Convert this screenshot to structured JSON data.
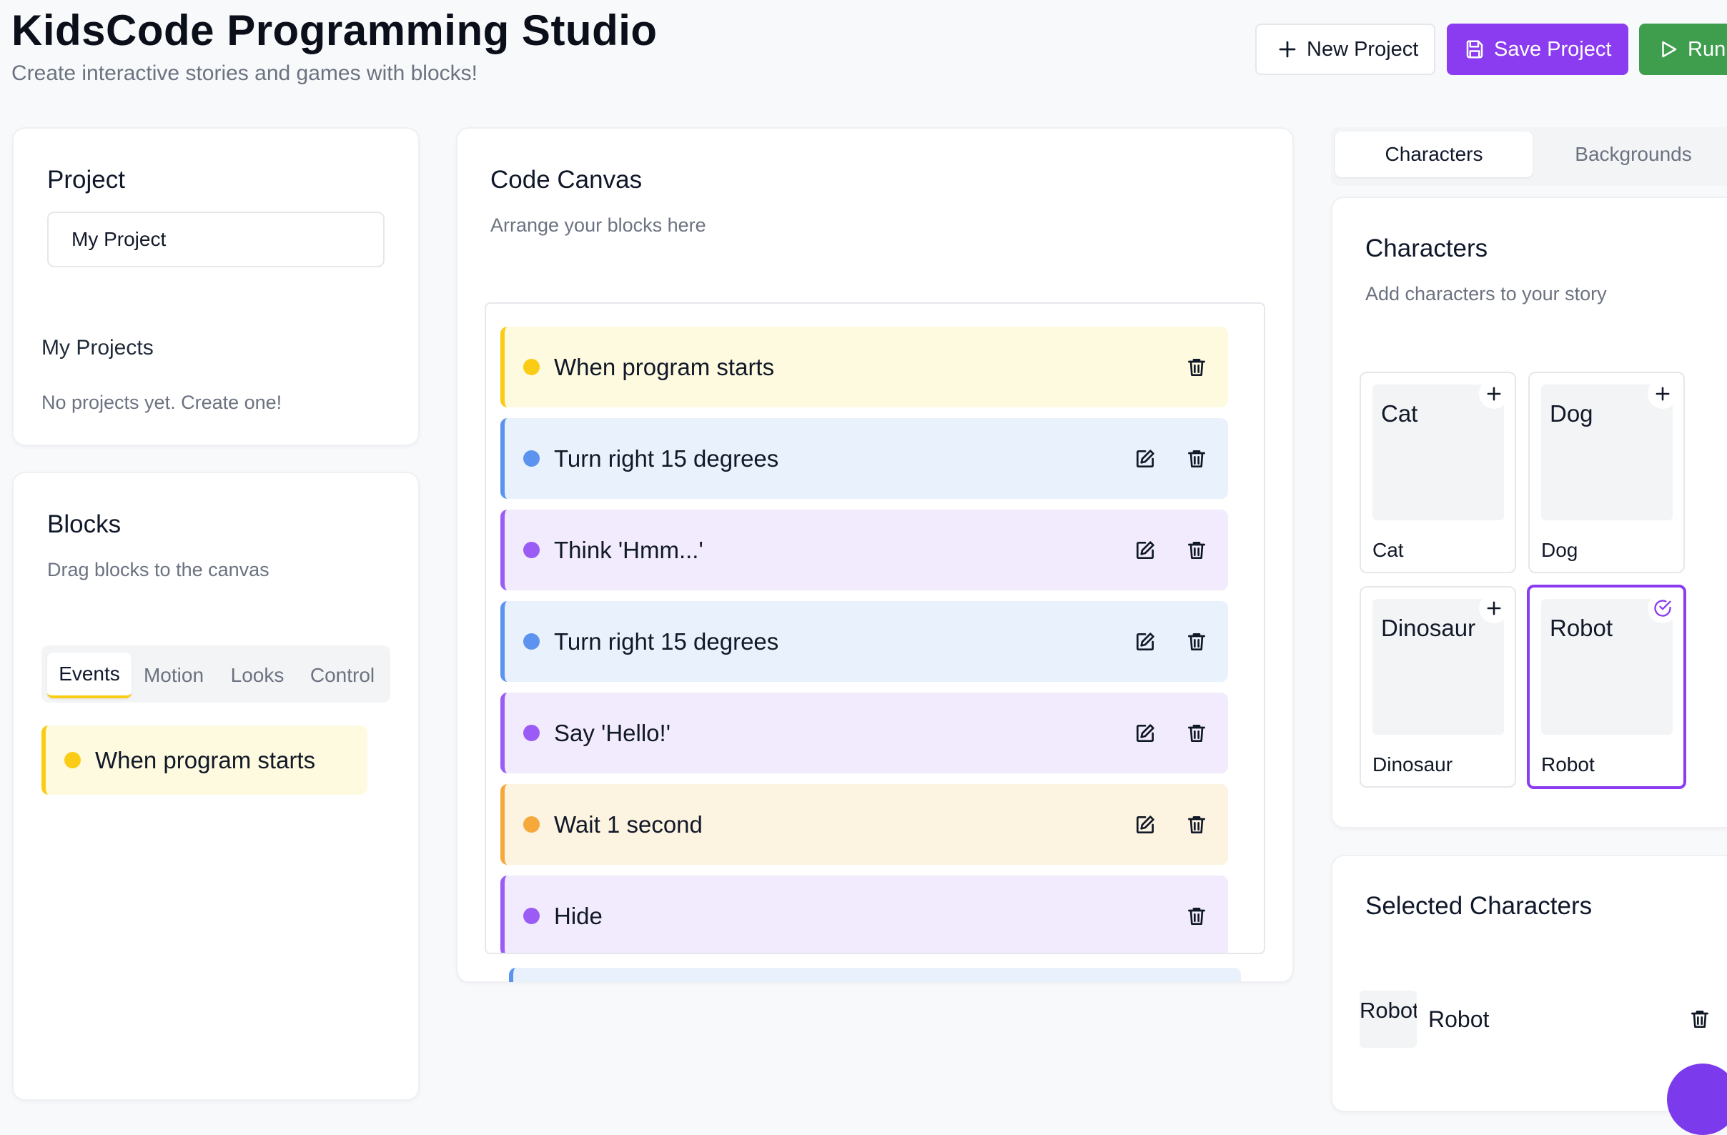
{
  "header": {
    "title": "KidsCode Programming Studio",
    "subtitle": "Create interactive stories and games with blocks!",
    "new_project_label": "New Project",
    "save_project_label": "Save Project",
    "run_label": "Run"
  },
  "project_panel": {
    "title": "Project",
    "name_value": "My Project",
    "my_projects_title": "My Projects",
    "empty_text": "No projects yet. Create one!"
  },
  "blocks_panel": {
    "title": "Blocks",
    "description": "Drag blocks to the canvas",
    "tabs": [
      "Events",
      "Motion",
      "Looks",
      "Control"
    ],
    "active_tab": "Events",
    "palette": [
      {
        "label": "When program starts",
        "category": "events"
      }
    ]
  },
  "canvas": {
    "title": "Code Canvas",
    "description": "Arrange your blocks here",
    "blocks": [
      {
        "label": "When program starts",
        "category": "events",
        "editable": false
      },
      {
        "label": "Turn right 15 degrees",
        "category": "motion",
        "editable": true
      },
      {
        "label": "Think 'Hmm...'",
        "category": "looks",
        "editable": true
      },
      {
        "label": "Turn right 15 degrees",
        "category": "motion",
        "editable": true
      },
      {
        "label": "Say 'Hello!'",
        "category": "looks",
        "editable": true
      },
      {
        "label": "Wait 1 second",
        "category": "control",
        "editable": true
      },
      {
        "label": "Hide",
        "category": "looks",
        "editable": false
      },
      {
        "label": "",
        "category": "motion",
        "editable": false
      }
    ]
  },
  "right_panel": {
    "tabs": [
      "Characters",
      "Backgrounds"
    ],
    "active_tab": "Characters",
    "characters_title": "Characters",
    "characters_description": "Add characters to your story",
    "characters": [
      {
        "name": "Cat",
        "thumb_text": "Cat",
        "selected": false
      },
      {
        "name": "Dog",
        "thumb_text": "Dog",
        "selected": false
      },
      {
        "name": "Dinosaur",
        "thumb_text": "Dinosaur",
        "selected": false
      },
      {
        "name": "Robot",
        "thumb_text": "Robot",
        "selected": true
      }
    ],
    "selected_title": "Selected Characters",
    "selected": [
      {
        "name": "Robot",
        "thumb_text": "Robot"
      }
    ]
  },
  "colors": {
    "accent_purple": "#8b3cf0",
    "run_green": "#3f9e4e",
    "events_yellow": "#facc15",
    "motion_blue": "#5b93ef",
    "looks_purple": "#9b5cf6",
    "control_orange": "#f5a93b"
  },
  "icons": {
    "new": "plus-icon",
    "save": "save-icon",
    "run": "play-icon",
    "edit": "edit-icon",
    "delete": "trash-icon",
    "add": "plus-icon",
    "selected": "check-circle-icon"
  }
}
